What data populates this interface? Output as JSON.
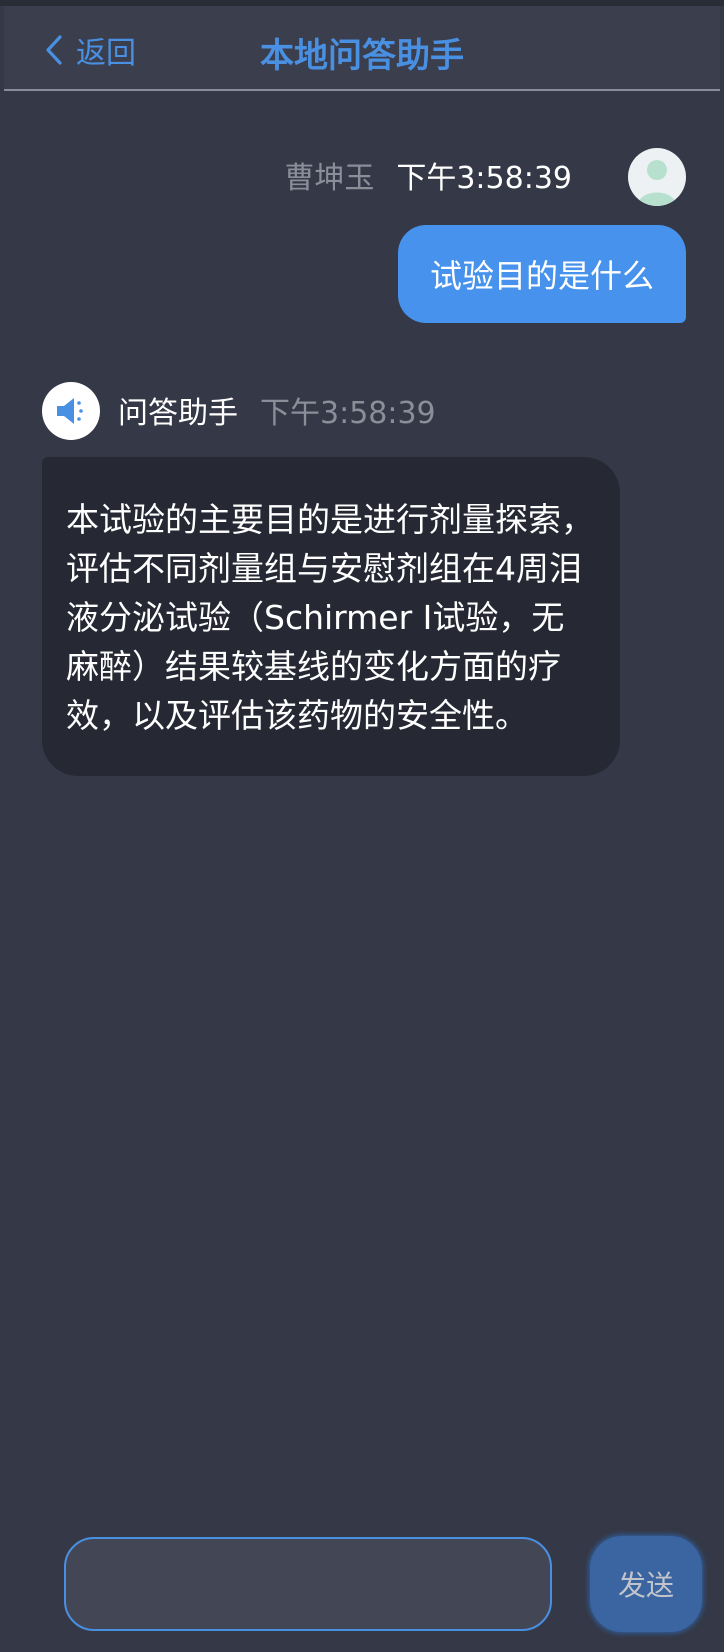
{
  "header": {
    "back_label": "返回",
    "title": "本地问答助手",
    "accent_color": "#4a90e2"
  },
  "messages": {
    "user": {
      "name": "曹坤玉",
      "time": "下午3:58:39",
      "text": "试验目的是什么",
      "avatar_icon": "user-avatar-icon"
    },
    "assistant": {
      "name": "问答助手",
      "time": "下午3:58:39",
      "text": "本试验的主要目的是进行剂量探索，评估不同剂量组与安慰剂组在4周泪液分泌试验（Schirmer I试验，无麻醉）结果较基线的变化方面的疗效，以及评估该药物的安全性。",
      "avatar_icon": "speaker-icon"
    }
  },
  "composer": {
    "input_value": "",
    "send_label": "发送"
  }
}
